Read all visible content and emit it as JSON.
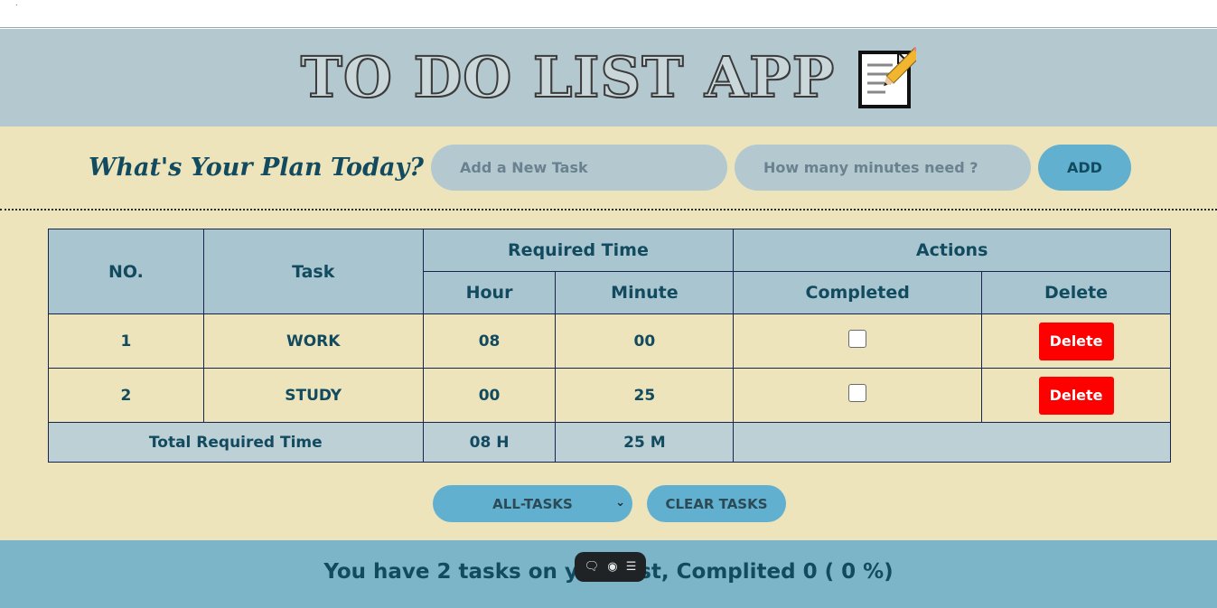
{
  "app": {
    "title": "TO DO LIST APP",
    "memo_icon": "memo-pencil-icon"
  },
  "form": {
    "prompt": "What's Your Plan Today?",
    "task_placeholder": "Add a New Task",
    "minutes_placeholder": "How many minutes need ?",
    "add_label": "ADD"
  },
  "table": {
    "headers": {
      "no": "NO.",
      "task": "Task",
      "required_time": "Required Time",
      "actions": "Actions",
      "hour": "Hour",
      "minute": "Minute",
      "completed": "Completed",
      "delete": "Delete"
    },
    "rows": [
      {
        "no": "1",
        "task": "WORK",
        "hour": "08",
        "minute": "00",
        "completed": false,
        "delete_label": "Delete"
      },
      {
        "no": "2",
        "task": "STUDY",
        "hour": "00",
        "minute": "25",
        "completed": false,
        "delete_label": "Delete"
      }
    ],
    "total": {
      "label": "Total Required Time",
      "hour": "08 H",
      "minute": "25 M"
    }
  },
  "controls": {
    "filter_selected": "ALL-TASKS",
    "clear_label": "CLEAR TASKS"
  },
  "footer": {
    "summary": "You have 2 tasks on your list, Complited 0 ( 0 %)",
    "toolbar_icons": [
      "comment-icon",
      "toggle-icon",
      "sliders-icon"
    ]
  },
  "colors": {
    "header_bg": "#b4c8d0",
    "main_bg": "#ede4bc",
    "accent": "#62b0cf",
    "text": "#124b5f",
    "delete": "#ff0000",
    "footer_bg": "#7cb4c8"
  }
}
